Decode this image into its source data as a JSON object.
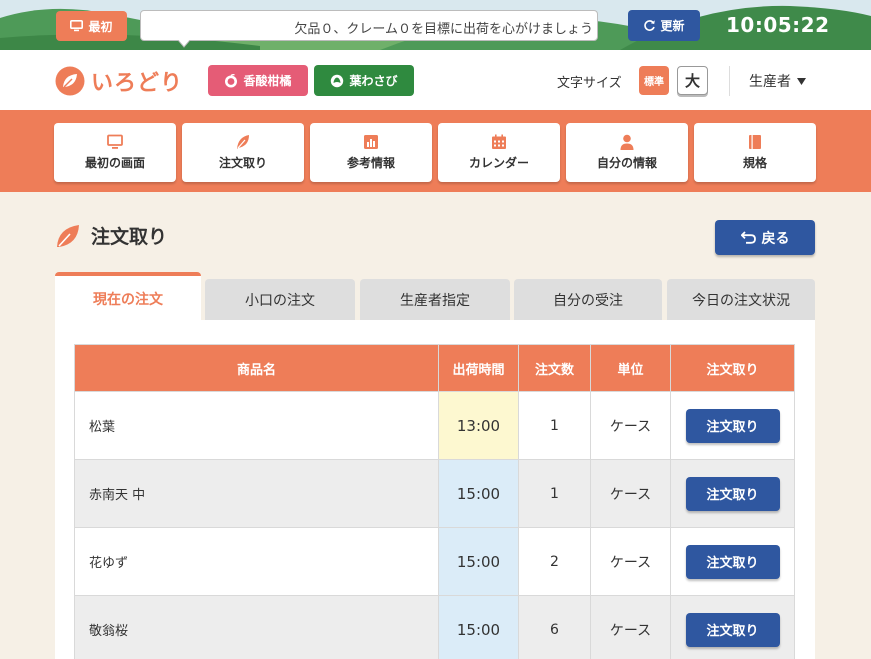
{
  "topbar": {
    "home_label": "最初",
    "ticker_text": "欠品０、クレーム０を目標に出荷を心がけましょう",
    "refresh_label": "更新",
    "clock": "10:05:22"
  },
  "header": {
    "logo_text": "いろどり",
    "chip_pink": "香酸柑橘",
    "chip_green": "葉わさび",
    "font_size_label": "文字サイズ",
    "font_size_standard": "標準",
    "font_size_large": "大",
    "user_role": "生産者"
  },
  "nav": {
    "items": [
      {
        "label": "最初の画面",
        "icon": "monitor-icon"
      },
      {
        "label": "注文取り",
        "icon": "leaf-icon"
      },
      {
        "label": "参考情報",
        "icon": "chart-icon"
      },
      {
        "label": "カレンダー",
        "icon": "calendar-icon"
      },
      {
        "label": "自分の情報",
        "icon": "person-icon"
      },
      {
        "label": "規格",
        "icon": "book-icon"
      }
    ]
  },
  "page": {
    "title": "注文取り",
    "back_label": "戻る"
  },
  "tabs": [
    "現在の注文",
    "小口の注文",
    "生産者指定",
    "自分の受注",
    "今日の注文状況"
  ],
  "table": {
    "headers": [
      "商品名",
      "出荷時間",
      "注文数",
      "単位",
      "注文取り"
    ],
    "rows": [
      {
        "name": "松葉",
        "time": "13:00",
        "qty": "1",
        "unit": "ケース",
        "action": "注文取り"
      },
      {
        "name": "赤南天 中",
        "time": "15:00",
        "qty": "1",
        "unit": "ケース",
        "action": "注文取り"
      },
      {
        "name": "花ゆず",
        "time": "15:00",
        "qty": "2",
        "unit": "ケース",
        "action": "注文取り"
      },
      {
        "name": "敬翁桜",
        "time": "15:00",
        "qty": "6",
        "unit": "ケース",
        "action": "注文取り"
      }
    ]
  },
  "colors": {
    "accent": "#ee7d58",
    "primary_button": "#2f57a0",
    "pink_chip": "#e55c76",
    "green_chip": "#2f8a3f",
    "time_highlight_yellow": "#fdf8d0",
    "time_highlight_blue": "#dbecf8"
  }
}
